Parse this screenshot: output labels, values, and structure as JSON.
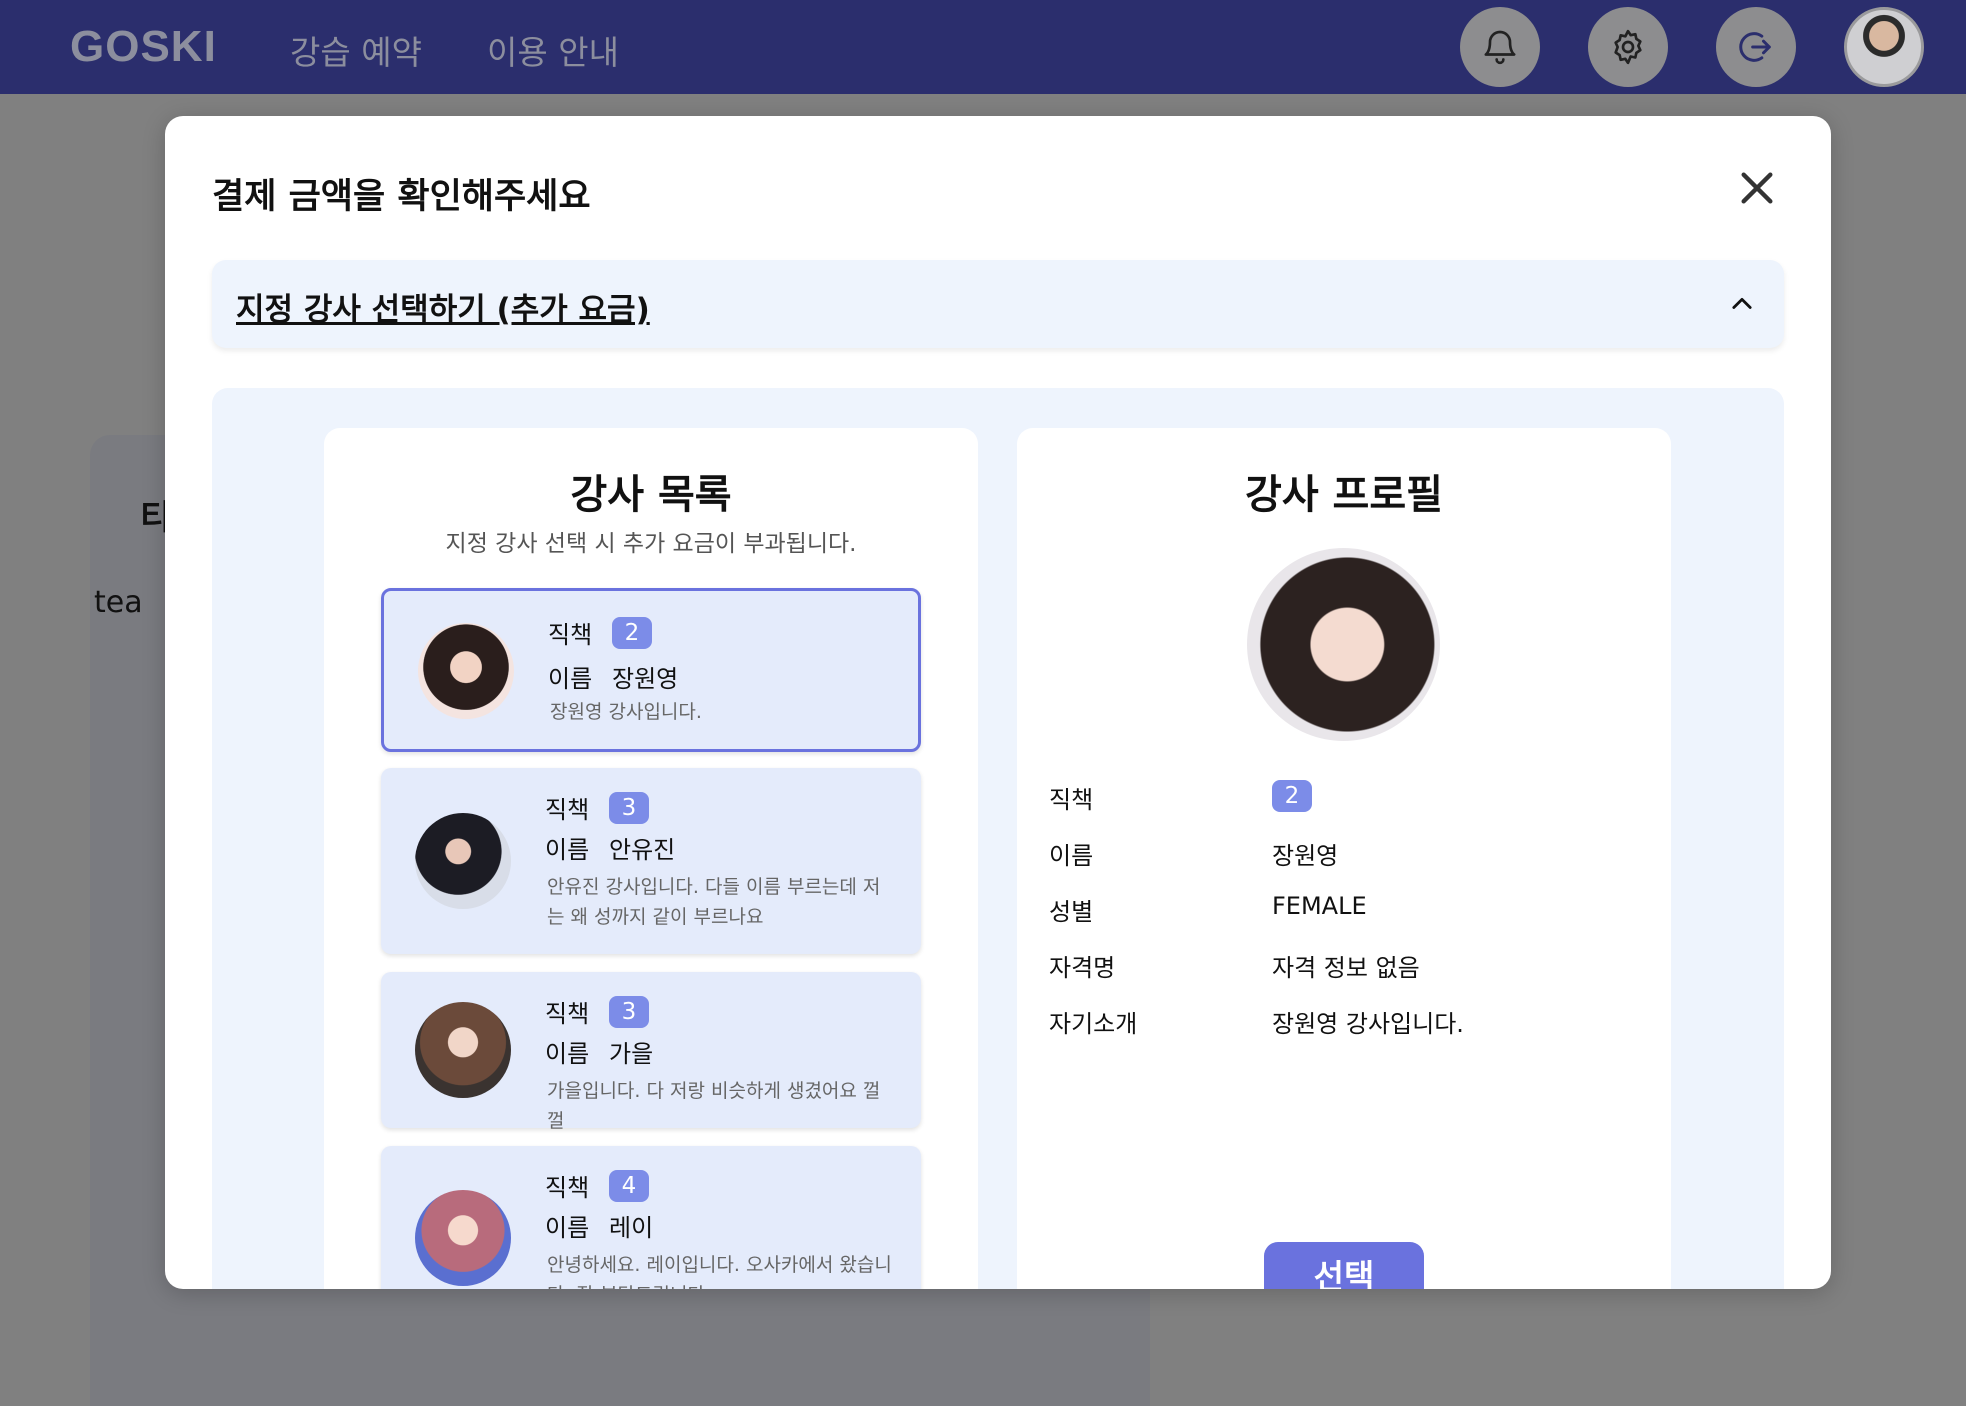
{
  "header": {
    "logo": "GOSKI",
    "nav": [
      "강습 예약",
      "이용 안내"
    ],
    "icons": [
      "bell-icon",
      "gear-icon",
      "logout-icon"
    ]
  },
  "background": {
    "title_fragment": "티",
    "image_alt_fragment": "tea"
  },
  "modal": {
    "title": "결제 금액을 확인해주세요",
    "accordion_label": "지정 강사 선택하기 (추가 요금)",
    "list": {
      "title": "강사 목록",
      "subtitle": "지정 강사 선택 시 추가 요금이 부과됩니다.",
      "field_labels": {
        "position": "직책",
        "name": "이름"
      },
      "instructors": [
        {
          "position": "2",
          "name": "장원영",
          "description": "장원영 강사입니다.",
          "selected": true
        },
        {
          "position": "3",
          "name": "안유진",
          "description": "안유진 강사입니다. 다들 이름 부르는데 저는 왜 성까지 같이 부르나요"
        },
        {
          "position": "3",
          "name": "가을",
          "description": "가을입니다. 다 저랑 비슷하게 생겼어요 껄껄"
        },
        {
          "position": "4",
          "name": "레이",
          "description": "안녕하세요. 레이입니다. 오사카에서 왔습니다. 잘 부탁드립니다"
        }
      ]
    },
    "profile": {
      "title": "강사 프로필",
      "rows": [
        {
          "label": "직책",
          "value": "2"
        },
        {
          "label": "이름",
          "value": "장원영"
        },
        {
          "label": "성별",
          "value": "FEMALE"
        },
        {
          "label": "자격명",
          "value": "자격 정보 없음"
        },
        {
          "label": "자기소개",
          "value": "장원영 강사입니다."
        }
      ],
      "select_button": "선택"
    }
  },
  "colors": {
    "navbar": "#2b2e6d",
    "accent": "#6a72de",
    "badge": "#7c8ce8",
    "panel": "#eef4fd",
    "card_item": "#e4ebfb"
  }
}
